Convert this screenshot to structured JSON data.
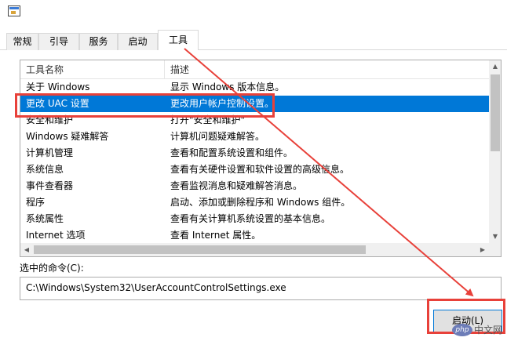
{
  "tabs": [
    "常规",
    "引导",
    "服务",
    "启动",
    "工具"
  ],
  "active_tab": "工具",
  "tools_list": {
    "columns": [
      "工具名称",
      "描述"
    ],
    "rows": [
      {
        "name": "关于 Windows",
        "desc": "显示 Windows 版本信息。"
      },
      {
        "name": "更改 UAC 设置",
        "desc": "更改用户帐户控制设置。",
        "selected": true
      },
      {
        "name": "安全和维护",
        "desc": "打开\"安全和维护\""
      },
      {
        "name": "Windows 疑难解答",
        "desc": "计算机问题疑难解答。"
      },
      {
        "name": "计算机管理",
        "desc": "查看和配置系统设置和组件。"
      },
      {
        "name": "系统信息",
        "desc": "查看有关硬件设置和软件设置的高级信息。"
      },
      {
        "name": "事件查看器",
        "desc": "查看监视消息和疑难解答消息。"
      },
      {
        "name": "程序",
        "desc": "启动、添加或删除程序和 Windows 组件。"
      },
      {
        "name": "系统属性",
        "desc": "查看有关计算机系统设置的基本信息。"
      },
      {
        "name": "Internet 选项",
        "desc": "查看 Internet 属性。"
      }
    ]
  },
  "selected_command": {
    "label": "选中的命令(C):",
    "value": "C:\\Windows\\System32\\UserAccountControlSettings.exe"
  },
  "launch_button": "启动(L)",
  "watermark": {
    "badge": "php",
    "text": "中文网"
  },
  "colors": {
    "selection": "#0078d7",
    "annotation": "#e8413a"
  }
}
